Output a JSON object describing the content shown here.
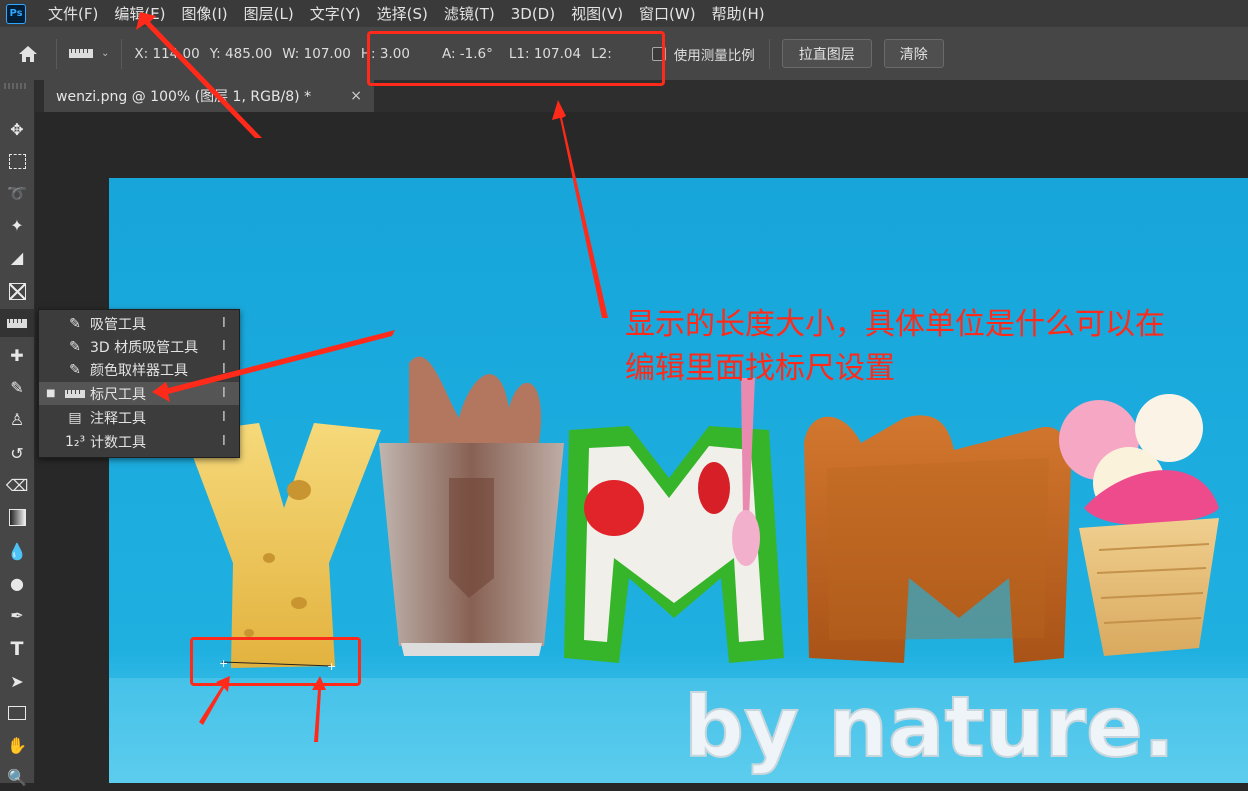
{
  "app": {
    "logo": "Ps"
  },
  "menubar": {
    "items": [
      "文件(F)",
      "编辑(E)",
      "图像(I)",
      "图层(L)",
      "文字(Y)",
      "选择(S)",
      "滤镜(T)",
      "3D(D)",
      "视图(V)",
      "窗口(W)",
      "帮助(H)"
    ]
  },
  "options": {
    "x": "X: 114.00",
    "y": "Y: 485.00",
    "w": "W: 107.00",
    "h": "H: 3.00",
    "a": "A: -1.6°",
    "l1": "L1: 107.04",
    "l2": "L2:",
    "use_scale_label": "使用测量比例",
    "straighten_label": "拉直图层",
    "clear_label": "清除"
  },
  "document": {
    "tab_title": "wenzi.png @ 100% (图层 1, RGB/8) *",
    "close": "×"
  },
  "tool_popup": {
    "items": [
      {
        "label": "吸管工具",
        "key": "I",
        "icon": "eyedropper-icon",
        "glyph": "✎"
      },
      {
        "label": "3D 材质吸管工具",
        "key": "I",
        "icon": "3d-material-eyedropper-icon",
        "glyph": "✎"
      },
      {
        "label": "颜色取样器工具",
        "key": "I",
        "icon": "color-sampler-icon",
        "glyph": "✎"
      },
      {
        "label": "标尺工具",
        "key": "I",
        "icon": "ruler-icon",
        "glyph": "▭",
        "selected": true
      },
      {
        "label": "注释工具",
        "key": "I",
        "icon": "note-icon",
        "glyph": "▤"
      },
      {
        "label": "计数工具",
        "key": "I",
        "icon": "count-icon",
        "glyph": "1₂³"
      }
    ]
  },
  "canvas": {
    "yummy": "YUMMY",
    "slogan": "by nature."
  },
  "annotation": {
    "text_line1": "显示的长度大小，具体单位是什么可以在",
    "text_line2": "编辑里面找标尺设置"
  },
  "colors": {
    "annotation_red": "#ff2a1a",
    "bg_blue": "#1aa3d6"
  }
}
